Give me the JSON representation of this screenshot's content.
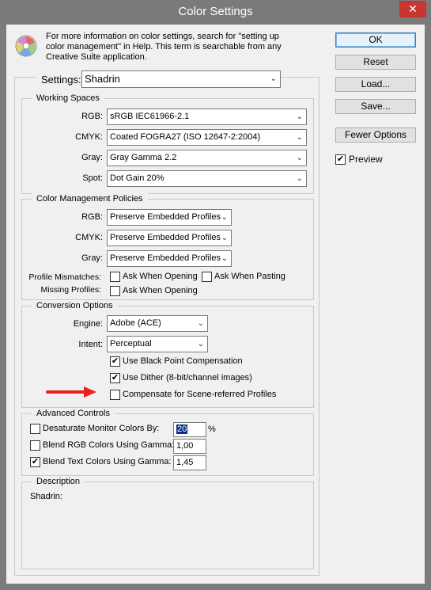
{
  "window": {
    "title": "Color Settings",
    "close_glyph": "✕"
  },
  "info": {
    "line1": "For more information on color settings, search for \"setting up",
    "line2": "color management\" in Help. This term is searchable from any",
    "line3": "Creative Suite application."
  },
  "buttons": {
    "ok": "OK",
    "reset": "Reset",
    "load": "Load...",
    "save": "Save...",
    "fewer_options": "Fewer Options"
  },
  "preview": {
    "label": "Preview",
    "checked": true
  },
  "settings": {
    "label": "Settings:",
    "value": "Shadrin"
  },
  "working_spaces": {
    "title": "Working Spaces",
    "rgb_label": "RGB:",
    "rgb_value": "sRGB IEC61966-2.1",
    "cmyk_label": "CMYK:",
    "cmyk_value": "Coated FOGRA27 (ISO 12647-2:2004)",
    "gray_label": "Gray:",
    "gray_value": "Gray Gamma 2.2",
    "spot_label": "Spot:",
    "spot_value": "Dot Gain 20%"
  },
  "policies": {
    "title": "Color Management Policies",
    "rgb_label": "RGB:",
    "rgb_value": "Preserve Embedded Profiles",
    "cmyk_label": "CMYK:",
    "cmyk_value": "Preserve Embedded Profiles",
    "gray_label": "Gray:",
    "gray_value": "Preserve Embedded Profiles",
    "mismatch_label": "Profile Mismatches:",
    "ask_opening": "Ask When Opening",
    "ask_pasting": "Ask When Pasting",
    "missing_label": "Missing Profiles:",
    "ask_opening_missing": "Ask When Opening"
  },
  "conversion": {
    "title": "Conversion Options",
    "engine_label": "Engine:",
    "engine_value": "Adobe (ACE)",
    "intent_label": "Intent:",
    "intent_value": "Perceptual",
    "black_point": "Use Black Point Compensation",
    "dither": "Use Dither (8-bit/channel images)",
    "scene_referred": "Compensate for Scene-referred Profiles"
  },
  "advanced": {
    "title": "Advanced Controls",
    "desaturate": "Desaturate Monitor Colors By:",
    "desaturate_value": "20",
    "percent": "%",
    "blend_rgb": "Blend RGB Colors Using Gamma:",
    "blend_rgb_value": "1,00",
    "blend_text": "Blend Text Colors Using Gamma:",
    "blend_text_value": "1,45"
  },
  "description": {
    "title": "Description",
    "text": "Shadrin:"
  },
  "colors": {
    "arrow": "#e8231d",
    "accent": "#0b2f8a"
  },
  "icons": [
    "color-wheel-icon",
    "close-icon",
    "chevron-down-icon",
    "checkmark-icon",
    "red-arrow-icon"
  ]
}
